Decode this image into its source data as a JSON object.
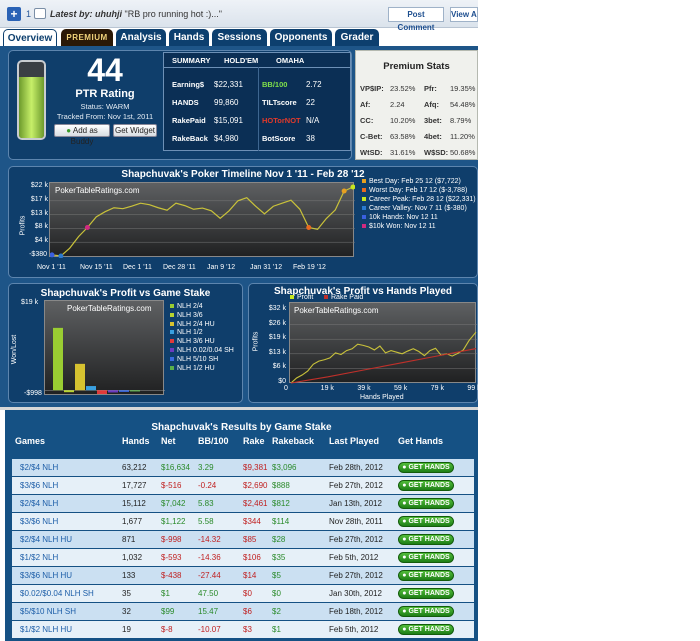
{
  "topbar": {
    "count": "1",
    "latest_label": "Latest by:",
    "latest_user": "uhuhji",
    "latest_quote": "\"RB pro running hot :)...\"",
    "post_comment": "Post Comment",
    "view_all": "View All"
  },
  "tabs": [
    "Overview",
    "PREMIUM",
    "Analysis",
    "Hands",
    "Sessions",
    "Opponents",
    "Grader"
  ],
  "player": {
    "name": "Shapchuvak",
    "ptr": "44",
    "ptr_label": "PTR Rating",
    "status": "Status: WARM",
    "tracked": "Tracked From: Nov 1st, 2011",
    "add_buddy": "Add as Buddy",
    "get_widget": "Get Widget",
    "gauge_level": 0.8
  },
  "summary": {
    "tabs": [
      "SUMMARY",
      "HOLD'EM",
      "OMAHA"
    ],
    "left": [
      {
        "label": "Earning$",
        "value": "$22,331"
      },
      {
        "label": "HANDS",
        "value": "99,860"
      },
      {
        "label": "RakePaid",
        "value": "$15,091"
      },
      {
        "label": "RakeBack",
        "value": "$4,980"
      }
    ],
    "right": [
      {
        "label": "BB/100",
        "value": "2.72"
      },
      {
        "label": "TILTscore",
        "value": "22"
      },
      {
        "label": "HOTorNOT",
        "value": "N/A"
      },
      {
        "label": "BotScore",
        "value": "38"
      }
    ]
  },
  "premium": {
    "title": "Premium Stats",
    "rows": [
      [
        "VP$IP:",
        "23.52%",
        "Pfr:",
        "19.35%"
      ],
      [
        "Af:",
        "2.24",
        "Afq:",
        "54.48%"
      ],
      [
        "CC:",
        "10.20%",
        "3bet:",
        "8.79%"
      ],
      [
        "C-Bet:",
        "63.58%",
        "4bet:",
        "11.20%"
      ],
      [
        "WtSD:",
        "31.61%",
        "W$SD:",
        "50.68%"
      ]
    ]
  },
  "timeline": {
    "title": "Shapchuvak's Poker Timeline Nov 1 '11 - Feb 28 '12",
    "watermark": "PokerTableRatings.com",
    "ylabel": "Profits",
    "legend": [
      {
        "text": "Best Day: Feb 25 12 ($7,722)",
        "color": "#e8a020"
      },
      {
        "text": "Worst Day: Feb 17 12 ($-3,788)",
        "color": "#e86a20"
      },
      {
        "text": "Career Peak: Feb 28 12 ($22,331)",
        "color": "#c8e820"
      },
      {
        "text": "Career Valley: Nov 7 11 ($-380)",
        "color": "#2a7ad0"
      },
      {
        "text": "10k Hands: Nov 12 11",
        "color": "#3a60e0"
      },
      {
        "text": "$10k Won: Nov 12 11",
        "color": "#d02a80"
      }
    ]
  },
  "stake_chart": {
    "title": "Shapchuvak's Profit vs Game Stake",
    "watermark": "PokerTableRatings.com",
    "ylabel": "Won/Lost",
    "legend": [
      {
        "text": "NLH 2/4",
        "color": "#9acd32"
      },
      {
        "text": "NLH 3/6",
        "color": "#b8d430"
      },
      {
        "text": "NLH 2/4 HU",
        "color": "#d6c230"
      },
      {
        "text": "NLH 1/2",
        "color": "#3aa0e0"
      },
      {
        "text": "NLH 3/6 HU",
        "color": "#e03a3a"
      },
      {
        "text": "NLH 0.02/0.04 SH",
        "color": "#6a3ac0"
      },
      {
        "text": "NLH 5/10 SH",
        "color": "#3a6ae0"
      },
      {
        "text": "NLH 1/2 HU",
        "color": "#5ab04a"
      }
    ]
  },
  "hands_chart": {
    "title": "Shapchuvak's Profit vs Hands Played",
    "watermark": "PokerTableRatings.com",
    "ylabel": "Profits",
    "xlabel": "Hands Played",
    "legend": [
      {
        "text": "Profit",
        "color": "#c8e820"
      },
      {
        "text": "Rake Paid",
        "color": "#c0302a"
      }
    ]
  },
  "results": {
    "title": "Shapchuvak's Results by Game Stake",
    "headers": [
      "Games",
      "Hands",
      "Net",
      "BB/100",
      "Rake",
      "Rakeback",
      "Last Played",
      "Get Hands"
    ],
    "btn": "GET HANDS",
    "rows": [
      [
        "$2/$4 NLH",
        "63,212",
        "$16,634",
        "3.29",
        "$9,381",
        "$3,096",
        "Feb 28th, 2012"
      ],
      [
        "$3/$6 NLH",
        "17,727",
        "$-516",
        "-0.24",
        "$2,690",
        "$888",
        "Feb 27th, 2012"
      ],
      [
        "$2/$4 NLH",
        "15,112",
        "$7,042",
        "5.83",
        "$2,461",
        "$812",
        "Jan 13th, 2012"
      ],
      [
        "$3/$6 NLH",
        "1,677",
        "$1,122",
        "5.58",
        "$344",
        "$114",
        "Nov 28th, 2011"
      ],
      [
        "$2/$4 NLH HU",
        "871",
        "$-998",
        "-14.32",
        "$85",
        "$28",
        "Feb 27th, 2012"
      ],
      [
        "$1/$2 NLH",
        "1,032",
        "$-593",
        "-14.36",
        "$106",
        "$35",
        "Feb 5th, 2012"
      ],
      [
        "$3/$6 NLH HU",
        "133",
        "$-438",
        "-27.44",
        "$14",
        "$5",
        "Feb 27th, 2012"
      ],
      [
        "$0.02/$0.04 NLH SH",
        "35",
        "$1",
        "47.50",
        "$0",
        "$0",
        "Jan 30th, 2012"
      ],
      [
        "$5/$10 NLH SH",
        "32",
        "$99",
        "15.47",
        "$6",
        "$2",
        "Feb 18th, 2012"
      ],
      [
        "$1/$2 NLH HU",
        "19",
        "$-8",
        "-10.07",
        "$3",
        "$1",
        "Feb 5th, 2012"
      ]
    ]
  },
  "chart_data": [
    {
      "type": "line",
      "title": "Shapchuvak's Poker Timeline Nov 1 '11 - Feb 28 '12",
      "ylabel": "Profits",
      "x_ticks": [
        "Nov 1 '11",
        "Nov 15 '11",
        "Dec 1 '11",
        "Dec 28 '11",
        "Jan 9 '12",
        "Jan 31 '12",
        "Feb 19 '12"
      ],
      "y_ticks": [
        "-$380",
        "$4 k",
        "$8 k",
        "$13 k",
        "$17 k",
        "$22 k"
      ],
      "ylim": [
        -380,
        22331
      ],
      "series": [
        {
          "name": "Profits",
          "values": [
            0,
            -380,
            2200,
            6000,
            9000,
            12500,
            14200,
            15500,
            15200,
            16000,
            17000,
            16500,
            15500,
            14700,
            17000,
            16200,
            15000,
            15400,
            14500,
            12000,
            14500,
            17800,
            18800,
            16000,
            13500,
            16000,
            17000,
            18000,
            15000,
            9000,
            8400,
            12000,
            14800,
            21000,
            22331
          ]
        }
      ]
    },
    {
      "type": "bar",
      "title": "Shapchuvak's Profit vs Game Stake",
      "ylabel": "Won/Lost",
      "y_ticks": [
        "$19 k",
        "-$998"
      ],
      "ylim": [
        -998,
        19000
      ],
      "categories": [
        "NLH 2/4",
        "NLH 3/6",
        "NLH 2/4 HU",
        "NLH 1/2",
        "NLH 3/6 HU",
        "NLH 0.02/0.04 SH",
        "NLH 5/10 SH",
        "NLH 1/2 HU"
      ],
      "values": [
        16634,
        -516,
        7042,
        1122,
        -998,
        -593,
        -438,
        1
      ]
    },
    {
      "type": "line",
      "title": "Shapchuvak's Profit vs Hands Played",
      "xlabel": "Hands Played",
      "ylabel": "Profits",
      "x_ticks": [
        "0",
        "19 k",
        "39 k",
        "59 k",
        "79 k",
        "99 k"
      ],
      "y_ticks": [
        "$0",
        "$6 k",
        "$13 k",
        "$19 k",
        "$26 k",
        "$32 k"
      ],
      "ylim": [
        0,
        32000
      ],
      "series": [
        {
          "name": "Profit",
          "x": [
            0,
            3,
            6,
            9,
            12,
            15,
            18,
            21,
            24,
            27,
            30,
            33,
            36,
            39,
            42,
            45,
            48,
            51,
            54,
            57,
            60,
            63,
            66,
            69,
            72,
            75,
            78,
            81,
            84,
            87,
            90,
            93,
            96,
            99.86
          ],
          "values": [
            0,
            2200,
            3500,
            5200,
            8200,
            9600,
            10200,
            11000,
            13200,
            12500,
            14200,
            15000,
            17000,
            16500,
            15800,
            14500,
            16200,
            13200,
            14200,
            13500,
            12800,
            14000,
            15000,
            13800,
            12000,
            14200,
            15200,
            12200,
            12800,
            11800,
            13000,
            14500,
            18500,
            22331
          ]
        },
        {
          "name": "Rake Paid",
          "x": [
            0,
            20,
            40,
            60,
            80,
            99.86
          ],
          "values": [
            0,
            2700,
            5800,
            8900,
            12000,
            15091
          ]
        }
      ]
    }
  ]
}
